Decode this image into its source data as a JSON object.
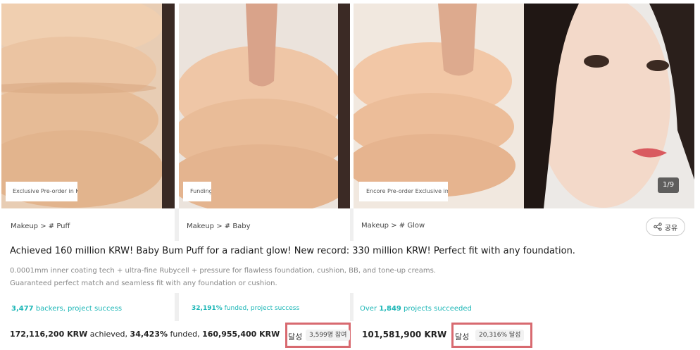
{
  "cards": [
    {
      "badge": "Exclusive Pre-order in Korea",
      "category": "Makeup > # Puff"
    },
    {
      "badge": "Funding",
      "category": "Makeup > # Baby"
    },
    {
      "badge": "Encore Pre-order Exclusive in Korea",
      "category": "Makeup > # Glow",
      "counter": "1/9"
    }
  ],
  "share_label": "공유",
  "title": "Achieved 160 million KRW! Baby Bum Puff for a radiant glow! New record: 330 million KRW! Perfect fit with any foundation.",
  "description": [
    "0.0001mm inner coating tech + ultra-fine Rubycell + pressure for flawless foundation, cushion, BB, and tone-up creams.",
    "Guaranteed perfect match and seamless fit with any foundation or cushion."
  ],
  "success": [
    {
      "value": "3,477",
      "text": " backers, project success"
    },
    {
      "value": "32,191%",
      "text": " funded, project success"
    },
    {
      "prefix": "Over ",
      "value": "1,849",
      "text": " projects succeeded"
    }
  ],
  "stats": {
    "amount1": "172,116,200 KRW",
    "achieved_word": " achieved, ",
    "percent": "34,423%",
    "funded_word": " funded, ",
    "amount2": "160,955,400 KRW",
    "suffix1": "달성",
    "pill1": "3,599명 참여",
    "amount3": "101,581,900 KRW",
    "suffix2": "달성",
    "pill2": "20,316% 달성"
  }
}
